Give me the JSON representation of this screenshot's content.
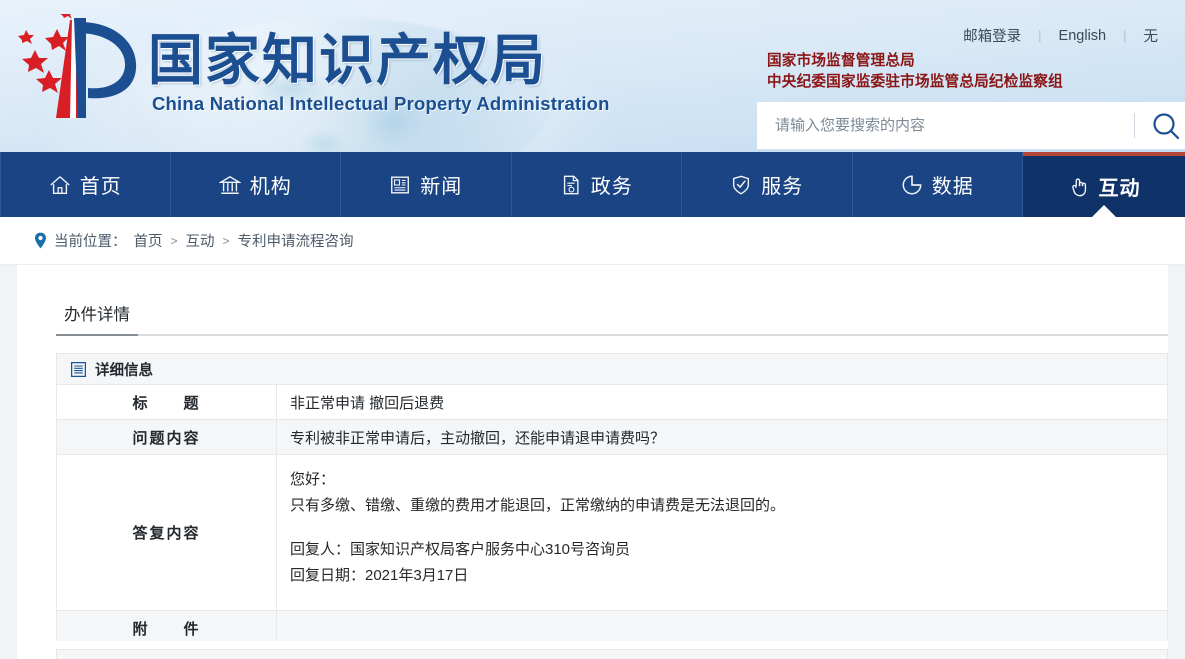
{
  "brand": {
    "cn_title": "国家知识产权局",
    "en_title": "China National Intellectual Property Administration",
    "logo_icon": "cnipa-logo-icon"
  },
  "header": {
    "top_links": [
      {
        "label": "邮箱登录",
        "name": "mail-login-link"
      },
      {
        "label": "English",
        "name": "english-link"
      },
      {
        "label": "无",
        "name": "accessibility-link"
      }
    ],
    "separator": "|",
    "agency_line1": "国家市场监督管理总局",
    "agency_line2": "中央纪委国家监委驻市场监管总局纪检监察组",
    "search": {
      "placeholder": "请输入您要搜索的内容",
      "value": "",
      "icon": "search-icon"
    }
  },
  "nav": {
    "items": [
      {
        "label": "首页",
        "icon": "home-icon",
        "active": false
      },
      {
        "label": "机构",
        "icon": "bank-icon",
        "active": false
      },
      {
        "label": "新闻",
        "icon": "newspaper-icon",
        "active": false
      },
      {
        "label": "政务",
        "icon": "document-icon",
        "active": false
      },
      {
        "label": "服务",
        "icon": "shield-icon",
        "active": false
      },
      {
        "label": "数据",
        "icon": "pie-chart-icon",
        "active": false
      },
      {
        "label": "互动",
        "icon": "hand-click-icon",
        "active": true
      }
    ],
    "active_index": 6,
    "bg_color": "#1b4485",
    "active_bg_color": "#0f3368",
    "active_accent_color": "#b4463c"
  },
  "breadcrumb": {
    "pin_icon": "location-pin-icon",
    "prefix": "当前位置：",
    "items": [
      "首页",
      "互动",
      "专利申请流程咨询"
    ],
    "separator": ">"
  },
  "content": {
    "tab_label": "办件详情",
    "section_icon": "list-panel-icon",
    "section_title": "详细信息",
    "rows": [
      {
        "label": "标　　题",
        "value": "非正常申请 撤回后退费"
      },
      {
        "label": "问题内容",
        "value": "专利被非正常申请后，主动撤回，还能申请退申请费吗？"
      },
      {
        "label": "答复内容",
        "value": ""
      },
      {
        "label": "附　　件",
        "value": ""
      }
    ],
    "answer": {
      "greeting": "您好：",
      "body": "只有多缴、错缴、重缴的费用才能退回，正常缴纳的申请费是无法退回的。",
      "responder": "回复人：国家知识产权局客户服务中心310号咨询员",
      "reply_date": "回复日期：2021年3月17日"
    }
  },
  "colors": {
    "brand_blue": "#1b4f91",
    "nav_blue": "#1b4485",
    "accent_red": "#b4463c",
    "agency_red": "#8b1414",
    "row_gray": "#f5f6f7",
    "page_gray": "#f2f3f5"
  }
}
